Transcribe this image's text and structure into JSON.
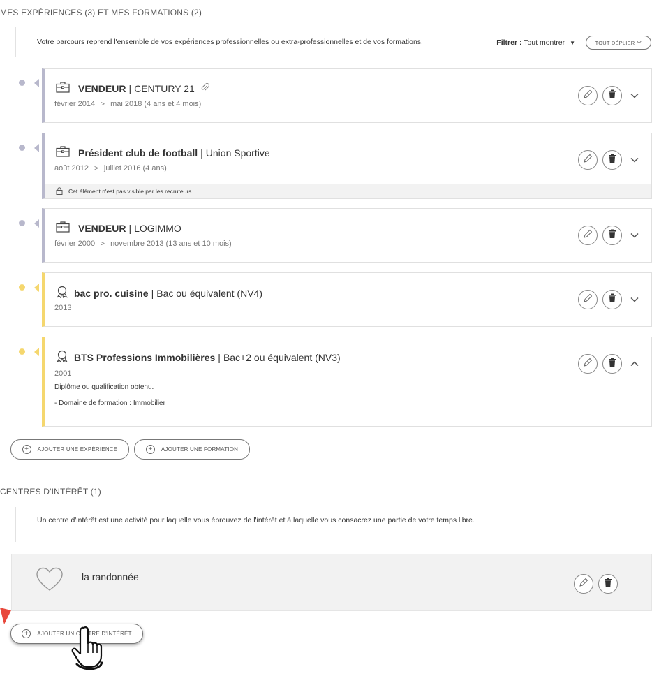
{
  "section_experiences": {
    "title": "MES EXPÉRIENCES (3) ET MES FORMATIONS (2)",
    "intro": "Votre parcours reprend l'ensemble de vos expériences professionnelles ou extra-professionnelles et de vos formations.",
    "filter_label": "Filtrer :",
    "filter_value": "Tout montrer",
    "expand_all": "TOUT DÉPLIER"
  },
  "items": [
    {
      "title": "VENDEUR",
      "org": "CENTURY 21",
      "start": "février 2014",
      "end": "mai 2018 (4 ans et 4 mois)",
      "icon": "briefcase-icon",
      "attachment": true
    },
    {
      "title": "Président club de football",
      "org": "Union Sportive",
      "start": "août 2012",
      "end": "juillet 2016 (4 ans)",
      "icon": "briefcase-icon",
      "notice": "Cet élément n'est pas visible par les recruteurs"
    },
    {
      "title": "VENDEUR",
      "org": "LOGIMMO",
      "start": "février 2000",
      "end": "novembre 2013 (13 ans et 10 mois)",
      "icon": "briefcase-icon"
    },
    {
      "title": "bac pro. cuisine",
      "org": "Bac ou équivalent (NV4)",
      "date": "2013",
      "icon": "award-icon"
    },
    {
      "title": "BTS Professions Immobilières",
      "org": "Bac+2 ou équivalent (NV3)",
      "date": "2001",
      "icon": "award-icon",
      "detail1": "Diplôme ou qualification obtenu.",
      "detail2": "- Domaine de formation : Immobilier"
    }
  ],
  "buttons": {
    "add_experience": "AJOUTER UNE EXPÉRIENCE",
    "add_formation": "AJOUTER UNE FORMATION",
    "add_interest": "AJOUTER UN CENTRE D'INTÉRÊT"
  },
  "section_interests": {
    "title": "CENTRES D'INTÉRÊT (1)",
    "intro": "Un centre d'intérêt est une activité pour laquelle vous éprouvez de l'intérêt et à laquelle vous consacrez une partie de votre temps libre.",
    "items": [
      {
        "label": "la randonnée",
        "icon": "heart-icon"
      }
    ]
  },
  "colors": {
    "experience_accent": "#b8b8cc",
    "formation_accent": "#f5d76e",
    "pointer_red": "#e8483c"
  }
}
